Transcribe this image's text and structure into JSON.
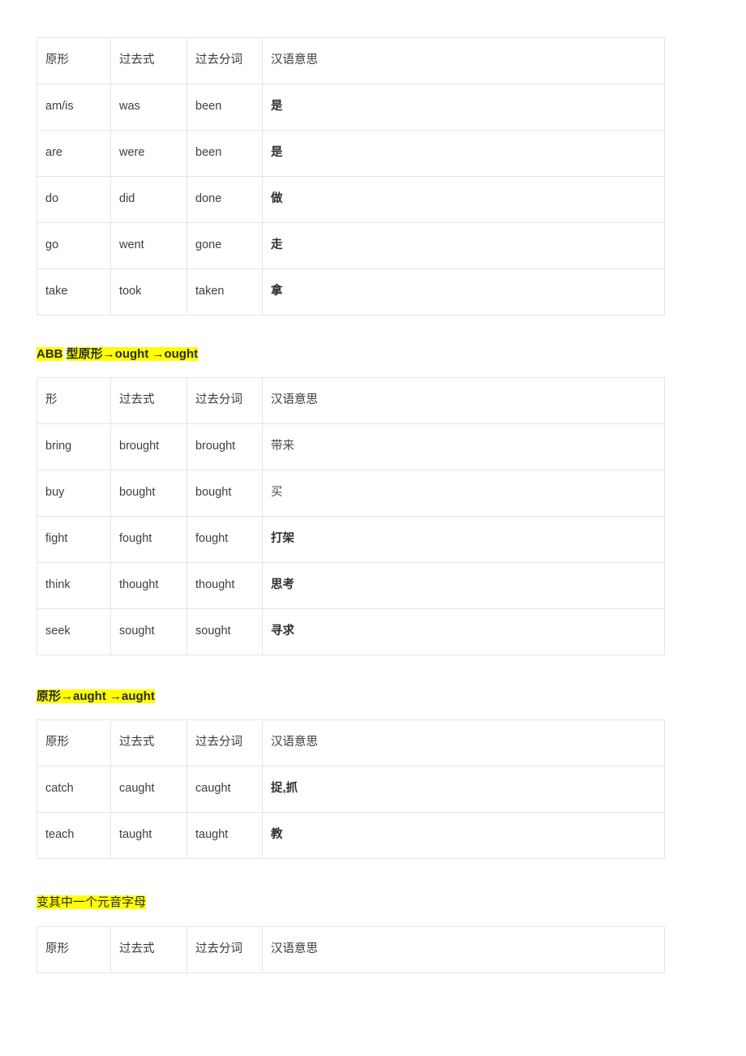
{
  "document": {
    "column_headers": {
      "base": "原形",
      "base_short": "形",
      "past": "过去式",
      "participle": "过去分词",
      "meaning": "汉语意思"
    },
    "sections": [
      {
        "id": "table-abb-be-do-go-take",
        "heading": null,
        "headers": [
          "原形",
          "过去式",
          "过去分词",
          "汉语意思"
        ],
        "meaning_bold": true,
        "rows": [
          {
            "base": "am/is",
            "past": "was",
            "participle": "been",
            "meaning": "是"
          },
          {
            "base": "are",
            "past": "were",
            "participle": "been",
            "meaning": "是"
          },
          {
            "base": "do",
            "past": "did",
            "participle": "done",
            "meaning": "做"
          },
          {
            "base": "go",
            "past": "went",
            "participle": "gone",
            "meaning": "走"
          },
          {
            "base": "take",
            "past": "took",
            "participle": "taken",
            "meaning": "拿"
          }
        ]
      },
      {
        "id": "table-ought",
        "heading": {
          "parts": [
            {
              "text": "ABB",
              "highlight": true,
              "bold": true
            },
            {
              "text": " ",
              "highlight": false,
              "bold": true
            },
            {
              "text": "型原形→ought →ought",
              "highlight": true,
              "bold": true
            }
          ],
          "plain_text": "ABB 型原形→ought →ought"
        },
        "headers": [
          "形",
          "过去式",
          "过去分词",
          "汉语意思"
        ],
        "meaning_bold": false,
        "rows": [
          {
            "base": "bring",
            "past": "brought",
            "participle": "brought",
            "meaning": "带来"
          },
          {
            "base": "buy",
            "past": "bought",
            "participle": "bought",
            "meaning": "买"
          },
          {
            "base": "fight",
            "past": "fought",
            "participle": "fought",
            "meaning": "打架"
          },
          {
            "base": "think",
            "past": "thought",
            "participle": "thought",
            "meaning": "思考"
          },
          {
            "base": "seek",
            "past": "sought",
            "participle": "sought",
            "meaning": "寻求"
          }
        ]
      },
      {
        "id": "table-aught",
        "heading": {
          "parts": [
            {
              "text": "原形→aught →aught",
              "highlight": true,
              "bold": true
            }
          ],
          "plain_text": "原形→aught →aught"
        },
        "headers": [
          "原形",
          "过去式",
          "过去分词",
          "汉语意思"
        ],
        "meaning_bold": true,
        "rows": [
          {
            "base": "catch",
            "past": "caught",
            "participle": "caught",
            "meaning": "捉,抓"
          },
          {
            "base": "teach",
            "past": "taught",
            "participle": "taught",
            "meaning": "教"
          }
        ]
      },
      {
        "id": "table-vowel-change",
        "heading": {
          "parts": [
            {
              "text": "变其中一个元音字母",
              "highlight": true,
              "bold": false
            }
          ],
          "plain_text": "变其中一个元音字母"
        },
        "headers": [
          "原形",
          "过去式",
          "过去分词",
          "汉语意思"
        ],
        "meaning_bold": true,
        "rows": []
      }
    ]
  },
  "colors": {
    "highlight": "#ffff00",
    "border": "#e4e4e4",
    "text": "#3a3a3a",
    "page_background": "#ffffff"
  }
}
